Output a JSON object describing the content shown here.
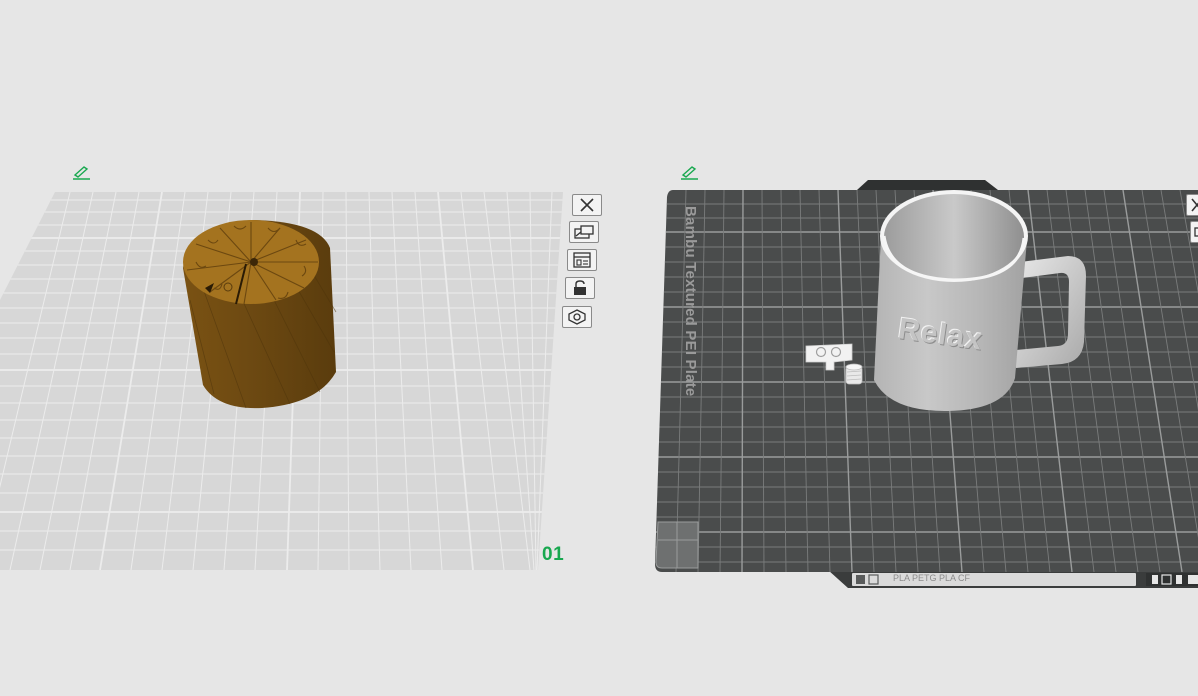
{
  "plates": [
    {
      "number_label": "01",
      "toolbar": {
        "items": [
          {
            "name": "close-icon"
          },
          {
            "name": "arrange-icon"
          },
          {
            "name": "orient-icon"
          },
          {
            "name": "lock-icon"
          },
          {
            "name": "settings-icon"
          }
        ]
      },
      "object": {
        "color": "#8a6019"
      }
    },
    {
      "plate_type_label": "Bambu Textured PEI Plate",
      "object_text": "Relax",
      "bottom_bar": {
        "text": "PLA  PETG  PLA CF"
      },
      "object": {
        "color": "#bdbdbd"
      }
    }
  ],
  "colors": {
    "background": "#e6e6e6",
    "plate_light": "#d7d7d7",
    "plate_dark": "#4a4c4c",
    "accent": "#18a84f",
    "object_brown": "#8a6019",
    "object_gray": "#bdbdbd"
  }
}
